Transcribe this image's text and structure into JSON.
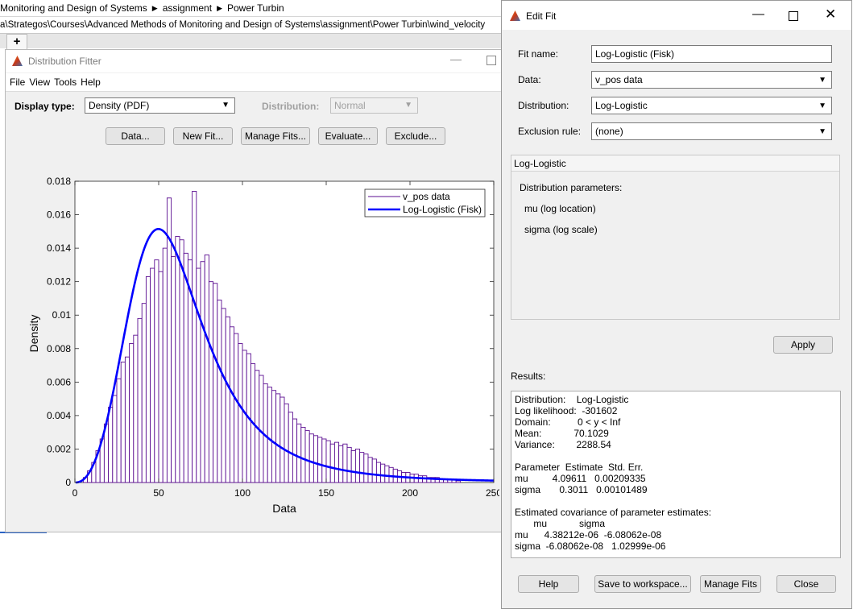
{
  "breadcrumb": {
    "items": [
      "Monitoring and Design of Systems",
      "assignment",
      "Power Turbin"
    ],
    "path": "a\\Strategos\\Courses\\Advanced Methods of Monitoring and Design of Systems\\assignment\\Power Turbin\\wind_velocity"
  },
  "editor": {
    "new_tab": "+"
  },
  "distribution_fitter": {
    "title": "Distribution Fitter",
    "menu": [
      "File",
      "View",
      "Tools",
      "Help"
    ],
    "display_type_label": "Display type:",
    "display_type_value": "Density (PDF)",
    "distribution_label": "Distribution:",
    "distribution_value": "Normal",
    "buttons": [
      "Data...",
      "New Fit...",
      "Manage Fits...",
      "Evaluate...",
      "Exclude..."
    ]
  },
  "chart_data": {
    "type": "bar",
    "xlabel": "Data",
    "ylabel": "Density",
    "xlim": [
      0,
      250
    ],
    "ylim": [
      0,
      0.018
    ],
    "xticks": [
      0,
      50,
      100,
      150,
      200,
      250
    ],
    "yticks": [
      0,
      0.002,
      0.004,
      0.006,
      0.008,
      0.01,
      0.012,
      0.014,
      0.016,
      0.018
    ],
    "xtick_labels": [
      "0",
      "50",
      "100",
      "150",
      "200",
      "250"
    ],
    "ytick_labels": [
      "0",
      "0.002",
      "0.004",
      "0.006",
      "0.008",
      "0.01",
      "0.012",
      "0.014",
      "0.016",
      "0.018"
    ],
    "legend": [
      "v_pos data",
      "Log-Logistic (Fisk)"
    ],
    "legend_position": "top-right",
    "histogram": {
      "name": "v_pos data",
      "bin_width": 2.5,
      "bin_start": 5,
      "values": [
        0.0003,
        0.0007,
        0.0012,
        0.0019,
        0.0026,
        0.0035,
        0.0045,
        0.0052,
        0.0062,
        0.0072,
        0.0075,
        0.0083,
        0.0088,
        0.0098,
        0.0107,
        0.0123,
        0.0128,
        0.0133,
        0.0126,
        0.014,
        0.017,
        0.0135,
        0.0147,
        0.0145,
        0.0137,
        0.0133,
        0.0174,
        0.0128,
        0.0132,
        0.0136,
        0.012,
        0.0119,
        0.0109,
        0.0104,
        0.0099,
        0.0093,
        0.0089,
        0.0083,
        0.0079,
        0.0077,
        0.0071,
        0.0067,
        0.0064,
        0.0059,
        0.0057,
        0.0055,
        0.0053,
        0.0051,
        0.0047,
        0.0042,
        0.0038,
        0.0035,
        0.0033,
        0.0031,
        0.0029,
        0.0028,
        0.0027,
        0.0026,
        0.0025,
        0.0023,
        0.0024,
        0.0022,
        0.0023,
        0.0021,
        0.0019,
        0.002,
        0.0018,
        0.0017,
        0.0015,
        0.0014,
        0.0012,
        0.0011,
        0.001,
        0.0009,
        0.0008,
        0.0007,
        0.0006,
        0.0006,
        0.0005,
        0.0005,
        0.0004,
        0.0004,
        0.0003,
        0.0003,
        0.0003,
        0.0002,
        0.0002,
        0.0002,
        0.0002,
        0.0001
      ]
    },
    "fit": {
      "name": "Log-Logistic (Fisk)",
      "distribution": "loglogistic",
      "mu": 4.09611,
      "sigma": 0.3011
    },
    "colors": {
      "histogram": "#5b0e91",
      "fit": "#0000ff"
    }
  },
  "edit_fit": {
    "title": "Edit Fit",
    "fit_name_label": "Fit name:",
    "fit_name_value": "Log-Logistic (Fisk)",
    "data_label": "Data:",
    "data_value": "v_pos data",
    "distribution_label": "Distribution:",
    "distribution_value": "Log-Logistic",
    "exclusion_label": "Exclusion rule:",
    "exclusion_value": "(none)",
    "panel_title": "Log-Logistic",
    "params_heading": "Distribution parameters:",
    "param1": "mu (log location)",
    "param2": "sigma (log scale)",
    "apply": "Apply",
    "results_label": "Results:",
    "results": [
      "Distribution:    Log-Logistic",
      "Log likelihood:  -301602",
      "Domain:          0 < y < Inf",
      "Mean:            70.1029",
      "Variance:        2288.54",
      "",
      "Parameter  Estimate  Std. Err.",
      "mu         4.09611   0.00209335",
      "sigma       0.3011   0.00101489",
      "",
      "Estimated covariance of parameter estimates:",
      "       mu            sigma",
      "mu      4.38212e-06  -6.08062e-08",
      "sigma  -6.08062e-08   1.02999e-06"
    ],
    "buttons": [
      "Help",
      "Save to workspace...",
      "Manage Fits",
      "Close"
    ]
  }
}
